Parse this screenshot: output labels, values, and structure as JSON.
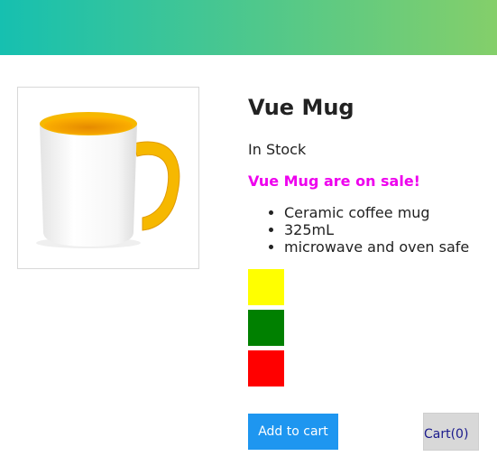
{
  "product": {
    "title": "Vue Mug",
    "stock_status": "In Stock",
    "sale_message": "Vue Mug are on sale!",
    "details": [
      "Ceramic coffee mug",
      "325mL",
      "microwave and oven safe"
    ],
    "image_icon": "mug-icon",
    "mug_colors": {
      "body": "#ffffff",
      "accent": "#f6b800"
    }
  },
  "variants": [
    {
      "color": "#ffff00",
      "name": "yellow"
    },
    {
      "color": "#008000",
      "name": "green"
    },
    {
      "color": "#ff0000",
      "name": "red"
    }
  ],
  "actions": {
    "add_to_cart_label": "Add to cart",
    "add_to_cart_color": "#1e96f0"
  },
  "cart": {
    "label": "Cart(0)"
  },
  "theme": {
    "nav_gradient_start": "#16c0b0",
    "nav_gradient_end": "#84cf6a",
    "sale_color": "#ee00ee"
  }
}
